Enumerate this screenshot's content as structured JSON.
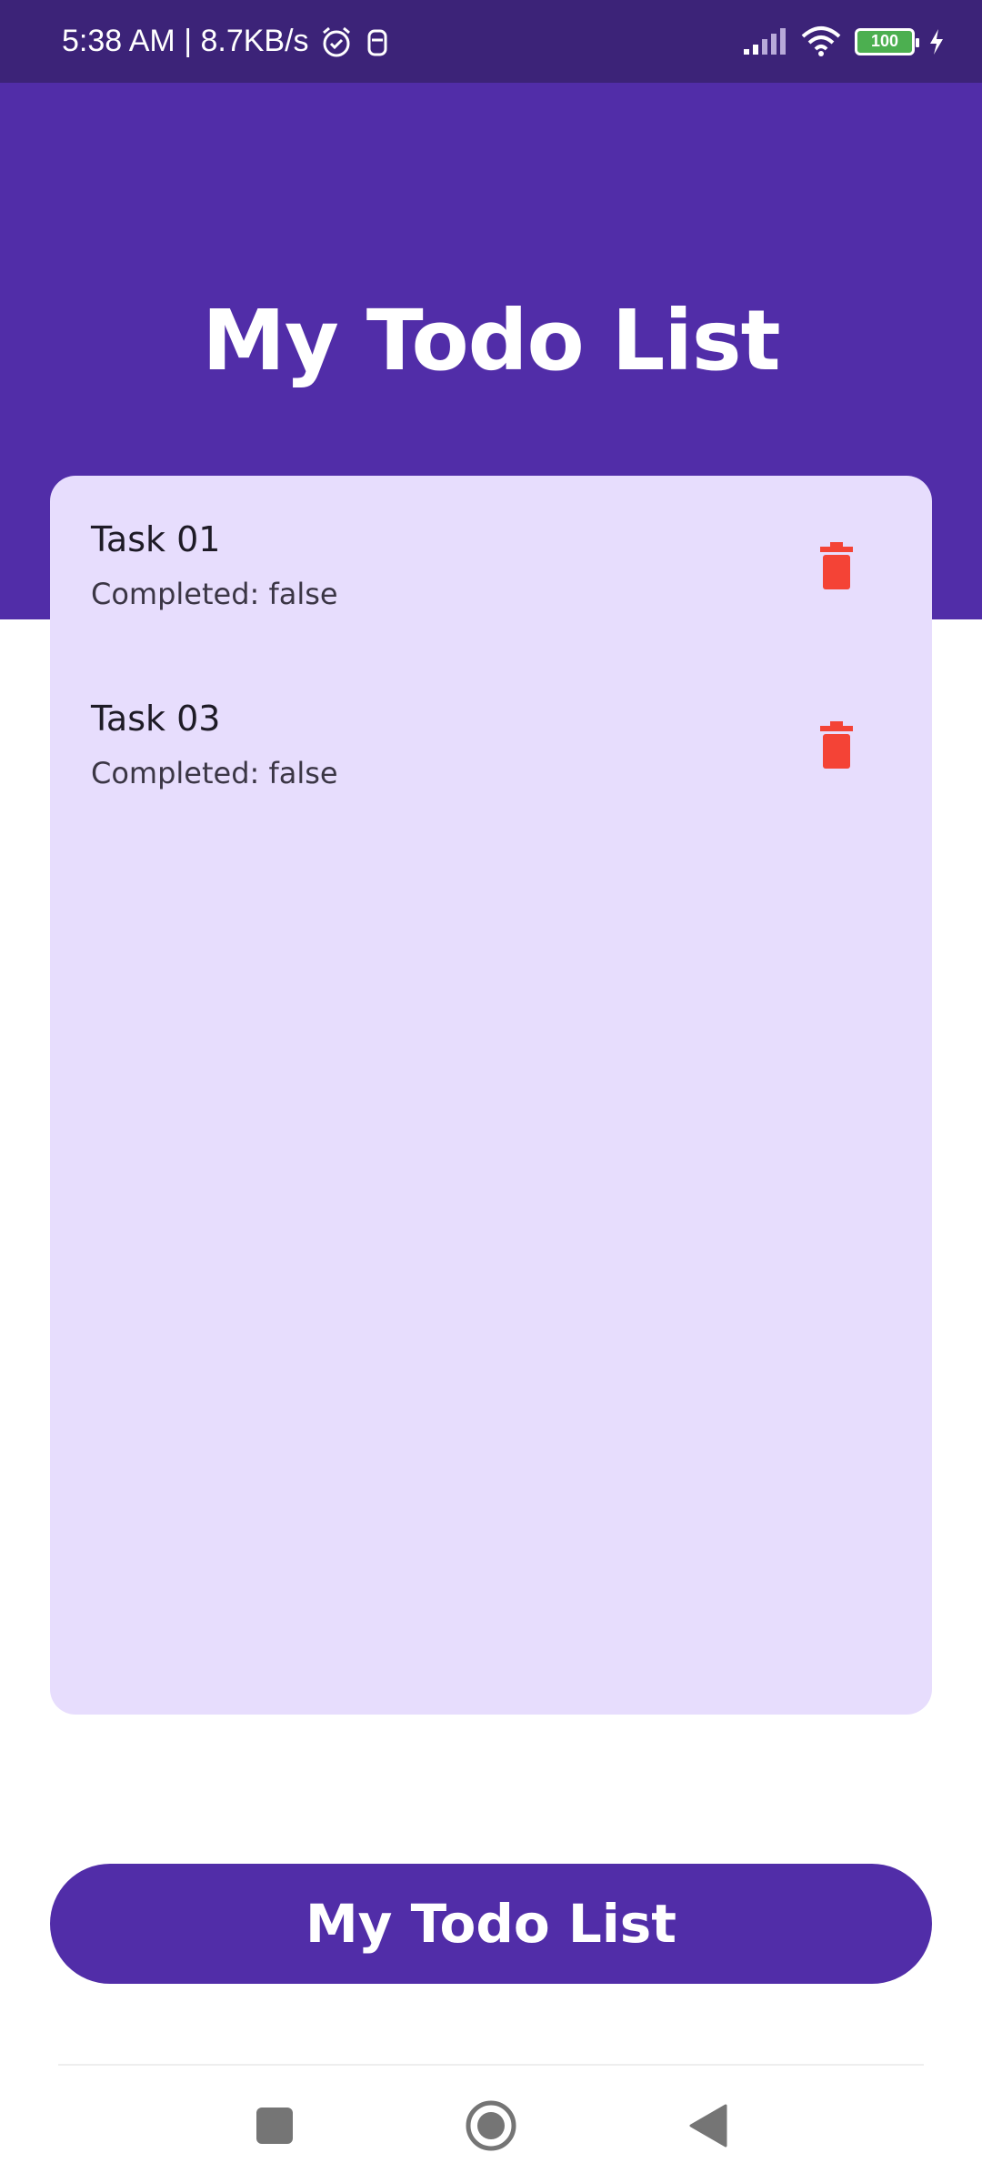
{
  "status_bar": {
    "time_speed": "5:38 AM | 8.7KB/s",
    "battery_level": "100",
    "icons": [
      "alarm-icon",
      "notification-icon",
      "signal-icon",
      "wifi-icon",
      "battery-icon",
      "charging-icon"
    ]
  },
  "header": {
    "title": "My Todo List"
  },
  "tasks": [
    {
      "title": "Task 01",
      "status": "Completed: false"
    },
    {
      "title": "Task 03",
      "status": "Completed: false"
    }
  ],
  "bottom_button": {
    "label": "My Todo List"
  },
  "nav": {
    "icons": [
      "recents-icon",
      "home-icon",
      "back-icon"
    ]
  },
  "colors": {
    "status_bar": "#3c2378",
    "primary": "#512da8",
    "card_bg": "#e7ddfd",
    "delete": "#f44336"
  }
}
